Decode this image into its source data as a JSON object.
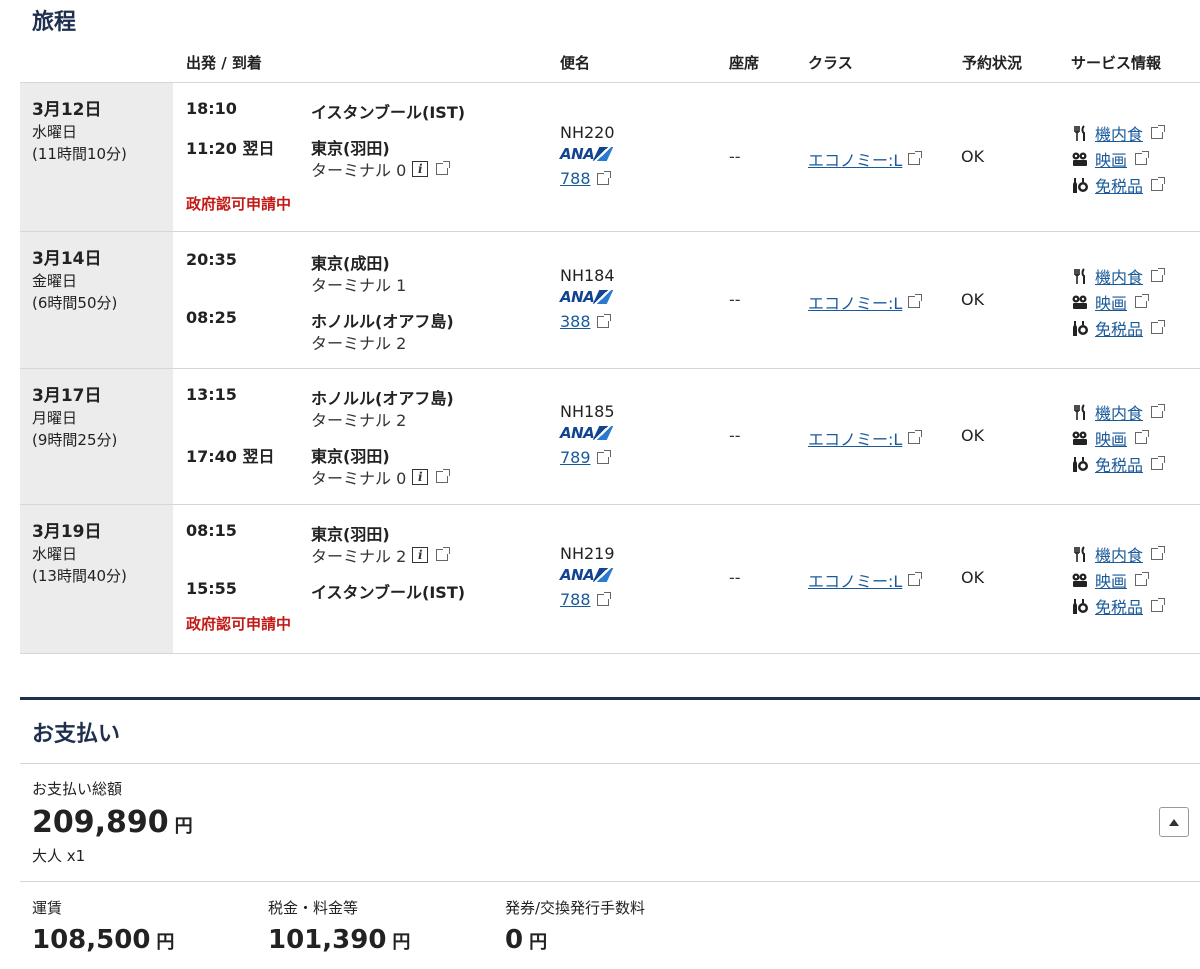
{
  "itinerary": {
    "title": "旅程",
    "headers": {
      "dep_arr": "出発 / 到着",
      "flight": "便名",
      "seat": "座席",
      "class": "クラス",
      "status": "予約状況",
      "service": "サービス情報"
    },
    "segments": [
      {
        "date": "3月12日",
        "dow": "水曜日",
        "duration": "(11時間10分)",
        "dep_time": "18:10",
        "dep_city": "イスタンブール(IST)",
        "dep_terminal": "",
        "arr_time": "11:20 翌日",
        "arr_city": "東京(羽田)",
        "arr_terminal": "ターミナル 0",
        "notice": "政府認可申請中",
        "flight": "NH220",
        "aircraft": "788",
        "seat": "--",
        "class": "エコノミー:L",
        "status": "OK"
      },
      {
        "date": "3月14日",
        "dow": "金曜日",
        "duration": "(6時間50分)",
        "dep_time": "20:35",
        "dep_city": "東京(成田)",
        "dep_terminal": "ターミナル 1",
        "arr_time": "08:25",
        "arr_city": "ホノルル(オアフ島)",
        "arr_terminal": "ターミナル 2",
        "notice": "",
        "flight": "NH184",
        "aircraft": "388",
        "seat": "--",
        "class": "エコノミー:L",
        "status": "OK"
      },
      {
        "date": "3月17日",
        "dow": "月曜日",
        "duration": "(9時間25分)",
        "dep_time": "13:15",
        "dep_city": "ホノルル(オアフ島)",
        "dep_terminal": "ターミナル 2",
        "arr_time": "17:40 翌日",
        "arr_city": "東京(羽田)",
        "arr_terminal": "ターミナル 0",
        "notice": "",
        "flight": "NH185",
        "aircraft": "789",
        "seat": "--",
        "class": "エコノミー:L",
        "status": "OK"
      },
      {
        "date": "3月19日",
        "dow": "水曜日",
        "duration": "(13時間40分)",
        "dep_time": "08:15",
        "dep_city": "東京(羽田)",
        "dep_terminal": "ターミナル 2",
        "arr_time": "15:55",
        "arr_city": "イスタンブール(IST)",
        "arr_terminal": "",
        "notice": "政府認可申請中",
        "flight": "NH219",
        "aircraft": "788",
        "seat": "--",
        "class": "エコノミー:L",
        "status": "OK"
      }
    ],
    "services": {
      "meal": "機内食",
      "movie": "映画",
      "dutyfree": "免税品"
    },
    "airline_logo_text": "ANA"
  },
  "payment": {
    "title": "お支払い",
    "total_label": "お支払い総額",
    "total": "209,890",
    "currency": "円",
    "passengers": "大人 x1",
    "fare_label": "運賃",
    "fare": "108,500",
    "tax_label": "税金・料金等",
    "tax": "101,390",
    "fee_label": "発券/交換発行手数料",
    "fee": "0"
  },
  "colors": {
    "navy": "#1f2f4f",
    "link": "#1a5a9b",
    "alert": "#c21b17",
    "ana_blue": "#13448f"
  }
}
